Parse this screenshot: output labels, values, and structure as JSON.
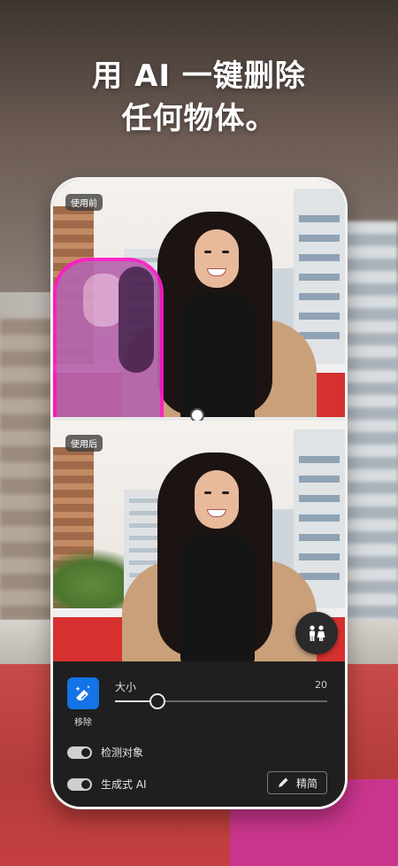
{
  "headline": {
    "line1": "用 AI 一键删除",
    "line2": "任何物体。"
  },
  "before_label": "使用前",
  "after_label": "使用后",
  "fab_icon": "people-icon",
  "tool": {
    "icon": "eraser-sparkle-icon",
    "label": "移除"
  },
  "brush": {
    "label": "大小",
    "value": "20",
    "level_fraction": 0.2
  },
  "toggles": [
    {
      "label": "检测对象",
      "on": true
    },
    {
      "label": "生成式 AI",
      "on": true
    }
  ],
  "refine": {
    "icon": "pencil-icon",
    "label": "精简"
  },
  "colors": {
    "accent": "#1473e6",
    "selection": "#ff19c8",
    "panel": "#1f1f1f"
  }
}
